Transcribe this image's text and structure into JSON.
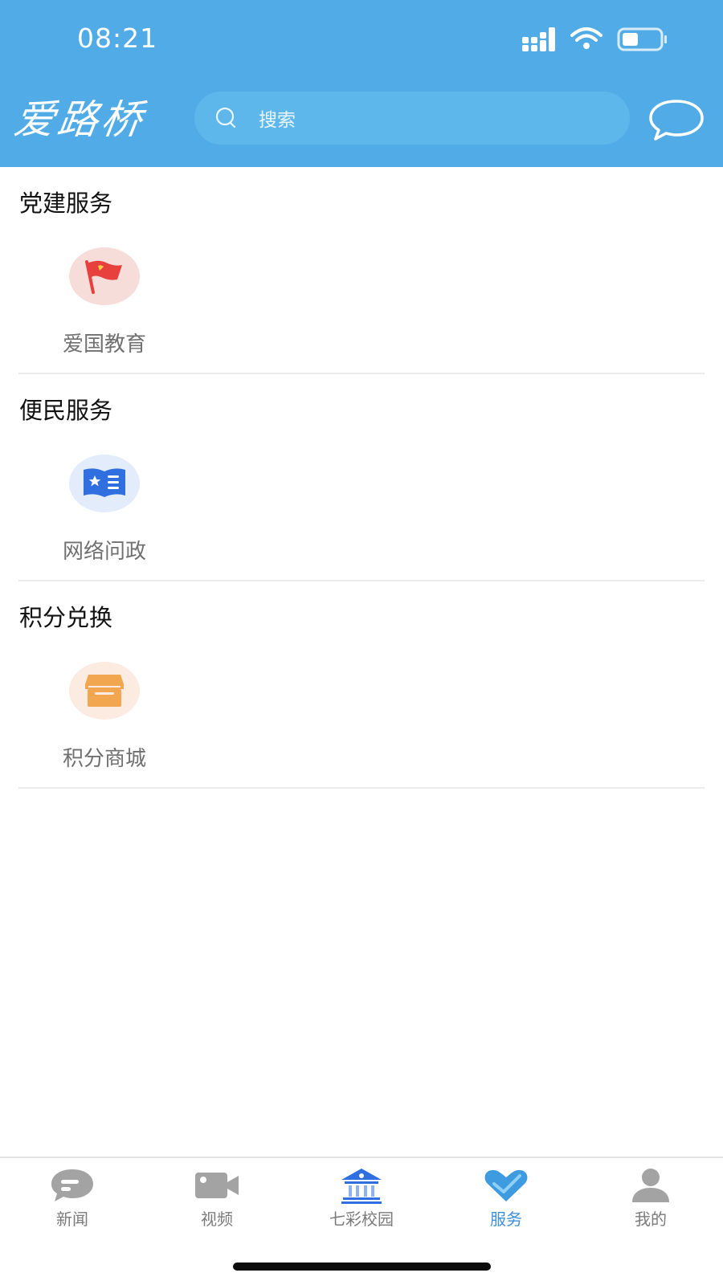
{
  "status": {
    "time": "08:21"
  },
  "header": {
    "brand": "爱路桥",
    "search_placeholder": "搜索",
    "bg_color": "#51abe6"
  },
  "sections": [
    {
      "title": "党建服务",
      "item": {
        "label": "爱国教育",
        "icon": "red-flag-icon",
        "circle_color": "#f7ddd9"
      }
    },
    {
      "title": "便民服务",
      "item": {
        "label": "网络问政",
        "icon": "political-book-icon",
        "circle_color": "#e3ecfb"
      }
    },
    {
      "title": "积分兑换",
      "item": {
        "label": "积分商城",
        "icon": "store-icon",
        "circle_color": "#fbebe0"
      }
    }
  ],
  "tabbar": {
    "active_color": "#3d8fd6",
    "items": [
      {
        "label": "新闻",
        "icon": "news-bubble-icon"
      },
      {
        "label": "视频",
        "icon": "video-camera-icon"
      },
      {
        "label": "七彩校园",
        "icon": "campus-building-icon"
      },
      {
        "label": "服务",
        "icon": "service-heart-icon",
        "active": true
      },
      {
        "label": "我的",
        "icon": "profile-icon"
      }
    ]
  }
}
